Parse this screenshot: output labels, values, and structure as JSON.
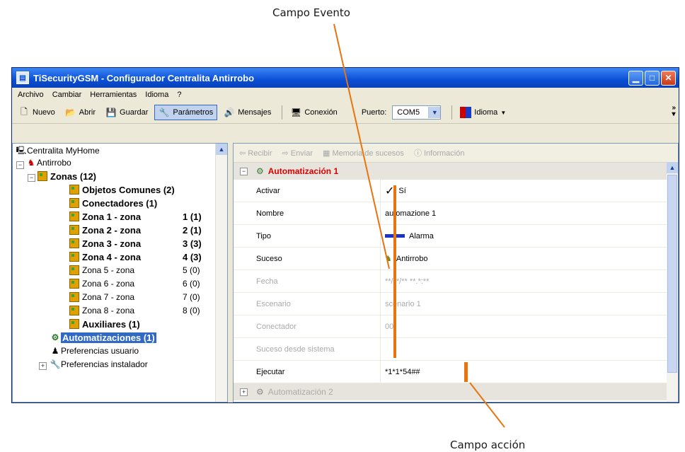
{
  "annotations": {
    "evento": "Campo Evento",
    "accion": "Campo acción"
  },
  "colors": {
    "leader": "#e8740f",
    "title_red": "#dd0000",
    "selection": "#316ac5"
  },
  "window": {
    "title": "TiSecurityGSM - Configurador Centralita Antirrobo"
  },
  "menu": [
    "Archivo",
    "Cambiar",
    "Herramientas",
    "Idioma",
    "?"
  ],
  "toolbar": {
    "nuevo": "Nuevo",
    "abrir": "Abrir",
    "guardar": "Guardar",
    "parametros": "Parámetros",
    "mensajes": "Mensajes",
    "conexion": "Conexión",
    "puerto_label": "Puerto:",
    "puerto_value": "COM5",
    "idioma": "Idioma"
  },
  "tree": {
    "root": "Centralita MyHome",
    "antirrobo": "Antirrobo",
    "zonas": "Zonas (12)",
    "objetos": "Objetos Comunes (2)",
    "conectadores": "Conectadores (1)",
    "zonas_list": [
      {
        "label": "Zona 1 - zona",
        "num": "1 (1)"
      },
      {
        "label": "Zona 2 - zona",
        "num": "2 (1)"
      },
      {
        "label": "Zona 3 - zona",
        "num": "3 (3)"
      },
      {
        "label": "Zona 4 - zona",
        "num": "4 (3)"
      },
      {
        "label": "Zona 5 - zona",
        "num": "5 (0)"
      },
      {
        "label": "Zona 6 - zona",
        "num": "6 (0)"
      },
      {
        "label": "Zona 7 - zona",
        "num": "7 (0)"
      },
      {
        "label": "Zona 8 - zona",
        "num": "8 (0)"
      }
    ],
    "auxiliares": "Auxiliares (1)",
    "automatizaciones": "Automatizaciones (1)",
    "pref_usuario": "Preferencias usuario",
    "pref_instalador": "Preferencias instalador"
  },
  "props_toolbar": [
    "Recibir",
    "Enviar",
    "Memoria de sucesos",
    "Información"
  ],
  "category1": "Automatización 1",
  "category2": "Automatización 2",
  "properties": [
    {
      "label": "Activar",
      "value": "Sí"
    },
    {
      "label": "Nombre",
      "value": "automazione 1"
    },
    {
      "label": "Tipo",
      "value": "Alarma"
    },
    {
      "label": "Suceso",
      "value": "Antirrobo"
    },
    {
      "label": "Fecha",
      "value": "**/**/** **.*:**"
    },
    {
      "label": "Escenario",
      "value": "scenario 1"
    },
    {
      "label": "Conectador",
      "value": "00"
    },
    {
      "label": "Suceso desde sistema",
      "value": ""
    },
    {
      "label": "Ejecutar",
      "value": "*1*1*54##"
    }
  ]
}
